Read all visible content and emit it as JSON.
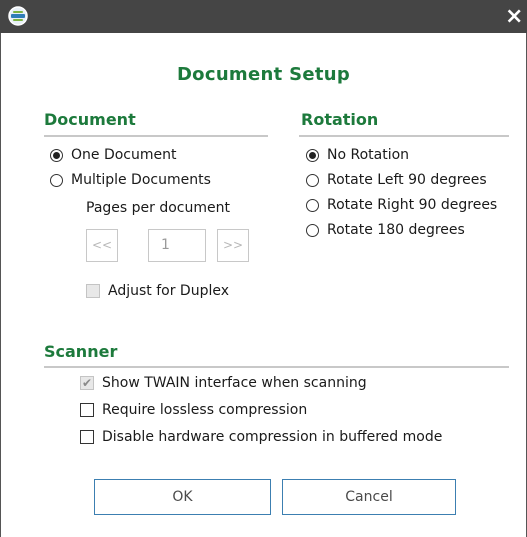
{
  "window": {
    "icon": "app-logo-icon",
    "close_glyph": "×"
  },
  "dialog": {
    "title": "Document Setup"
  },
  "document": {
    "section_title": "Document",
    "options": [
      {
        "label": "One Document",
        "selected": true
      },
      {
        "label": "Multiple Documents",
        "selected": false
      }
    ],
    "pages_label": "Pages per document",
    "prev_label": "<<",
    "next_label": ">>",
    "pages_value": "1",
    "duplex_label": "Adjust for Duplex",
    "duplex_checked": false
  },
  "rotation": {
    "section_title": "Rotation",
    "options": [
      {
        "label": "No Rotation",
        "selected": true
      },
      {
        "label": "Rotate Left 90 degrees",
        "selected": false
      },
      {
        "label": "Rotate Right 90 degrees",
        "selected": false
      },
      {
        "label": "Rotate 180 degrees",
        "selected": false
      }
    ]
  },
  "scanner": {
    "section_title": "Scanner",
    "options": [
      {
        "label": "Show TWAIN interface when scanning",
        "checked": true
      },
      {
        "label": "Require lossless compression",
        "checked": false
      },
      {
        "label": "Disable hardware compression in buffered mode",
        "checked": false
      }
    ]
  },
  "buttons": {
    "ok_label": "OK",
    "cancel_label": "Cancel"
  },
  "colors": {
    "accent_green": "#1d7a3c",
    "titlebar": "#454545",
    "button_border": "#3c7fb1"
  }
}
